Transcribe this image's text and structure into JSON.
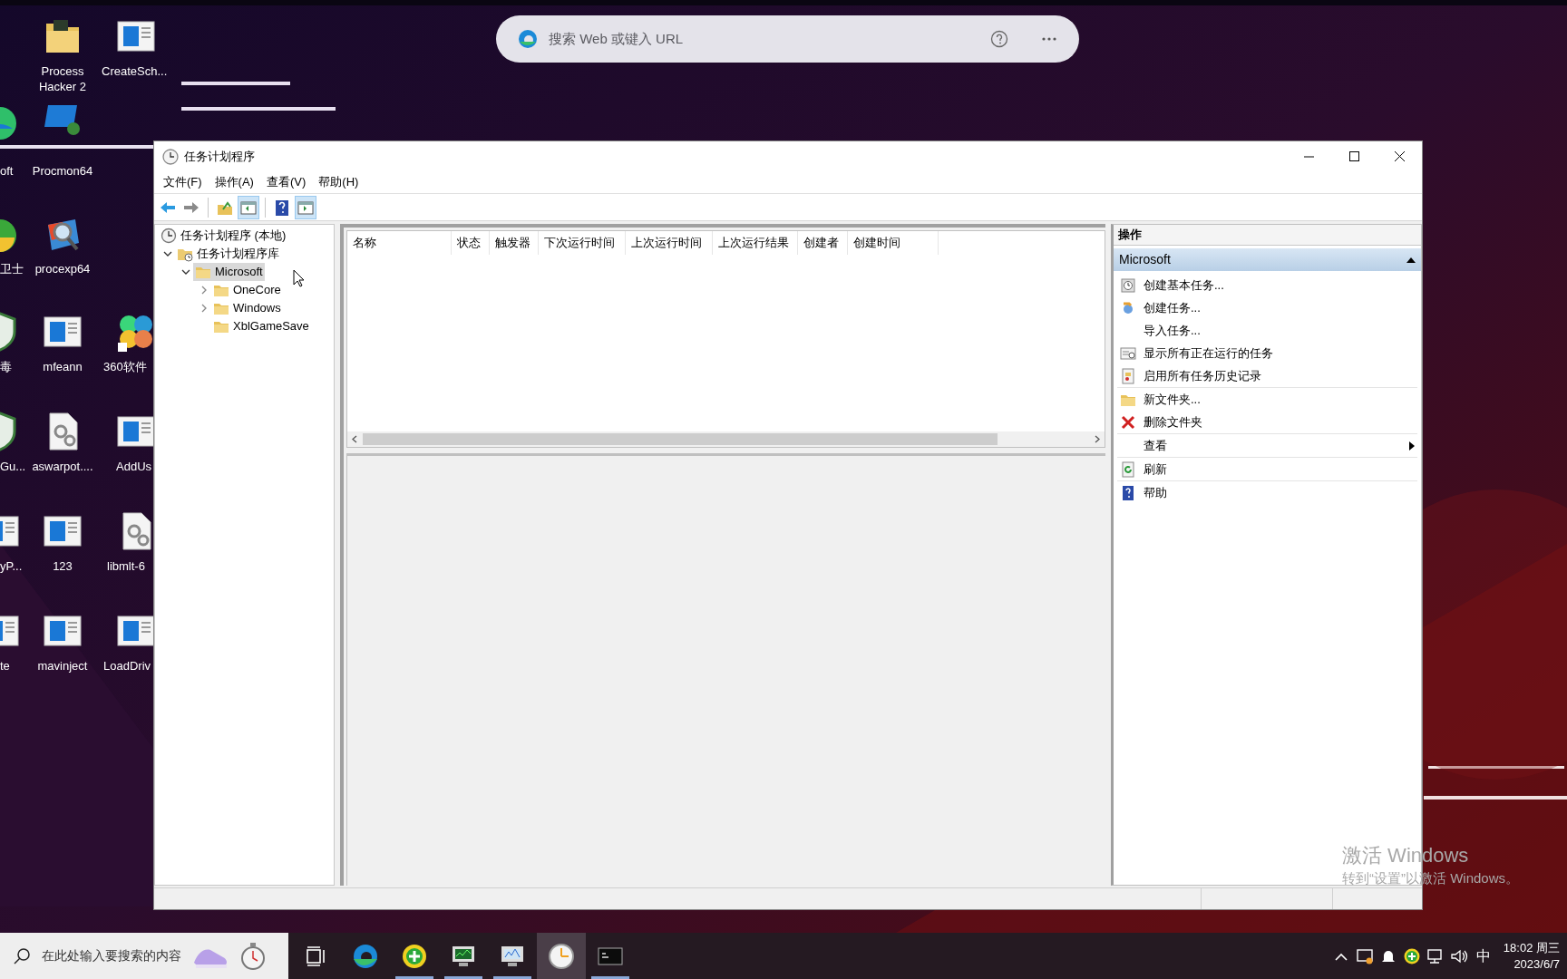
{
  "browser_search": {
    "placeholder": "搜索 Web 或键入 URL"
  },
  "desktop_icons": [
    {
      "label": "Process Hacker 2",
      "kind": "folder"
    },
    {
      "label": "CreateSch...",
      "kind": "doc"
    },
    {
      "label": "oft",
      "kind": "globe"
    },
    {
      "label": "Procmon64",
      "kind": "procmon"
    },
    {
      "label": "卫士",
      "kind": "ball"
    },
    {
      "label": "procexp64",
      "kind": "magnifier"
    },
    {
      "label": "毒",
      "kind": "shield"
    },
    {
      "label": "mfeann",
      "kind": "doc"
    },
    {
      "label": "360软件",
      "kind": "flower"
    },
    {
      "label": "Gu...",
      "kind": "shield"
    },
    {
      "label": "aswarpot....",
      "kind": "gear"
    },
    {
      "label": "AddUs",
      "kind": "doc"
    },
    {
      "label": "yP...",
      "kind": "doc"
    },
    {
      "label": "123",
      "kind": "doc"
    },
    {
      "label": "libmlt-6",
      "kind": "gear"
    },
    {
      "label": "te",
      "kind": "doc"
    },
    {
      "label": "mavinject",
      "kind": "doc"
    },
    {
      "label": "LoadDriv",
      "kind": "doc"
    }
  ],
  "window": {
    "title": "任务计划程序",
    "menu": [
      "文件(F)",
      "操作(A)",
      "查看(V)",
      "帮助(H)"
    ],
    "toolbar": [
      {
        "kind": "back"
      },
      {
        "kind": "forward"
      },
      {
        "kind": "separator"
      },
      {
        "kind": "up"
      },
      {
        "kind": "tree",
        "on": true
      },
      {
        "kind": "separator"
      },
      {
        "kind": "help"
      },
      {
        "kind": "actions",
        "on": true
      }
    ],
    "tree": [
      {
        "label": "任务计划程序 (本地)",
        "kind": "clock",
        "expandable": false,
        "selected": false,
        "children": [
          {
            "label": "任务计划程序库",
            "kind": "library",
            "expandable": true,
            "expanded": true,
            "selected": false,
            "children": [
              {
                "label": "Microsoft",
                "kind": "folder",
                "expandable": true,
                "expanded": true,
                "selected": true,
                "children": [
                  {
                    "label": "OneCore",
                    "kind": "folder",
                    "expandable": true,
                    "expanded": false,
                    "selected": false
                  },
                  {
                    "label": "Windows",
                    "kind": "folder",
                    "expandable": true,
                    "expanded": false,
                    "selected": false
                  },
                  {
                    "label": "XblGameSave",
                    "kind": "folder",
                    "expandable": false,
                    "selected": false
                  }
                ]
              }
            ]
          }
        ]
      }
    ],
    "table": {
      "columns": [
        "名称",
        "状态",
        "触发器",
        "下次运行时间",
        "上次运行时间",
        "上次运行结果",
        "创建者",
        "创建时间"
      ]
    },
    "actions": {
      "title": "操作",
      "group": {
        "label": "Microsoft",
        "expanded": true
      },
      "sections": [
        [
          {
            "label": "创建基本任务...",
            "kind": "basic-task",
            "submenu": false
          },
          {
            "label": "创建任务...",
            "kind": "task",
            "submenu": false
          },
          {
            "label": "导入任务...",
            "kind": "plain",
            "submenu": false
          },
          {
            "label": "显示所有正在运行的任务",
            "kind": "running",
            "submenu": false
          },
          {
            "label": "启用所有任务历史记录",
            "kind": "history",
            "submenu": false
          }
        ],
        [
          {
            "label": "新文件夹...",
            "kind": "new-folder",
            "submenu": false
          },
          {
            "label": "删除文件夹",
            "kind": "delete",
            "submenu": false
          }
        ],
        [
          {
            "label": "查看",
            "kind": "plain",
            "submenu": true
          }
        ],
        [
          {
            "label": "刷新",
            "kind": "refresh",
            "submenu": false
          }
        ],
        [
          {
            "label": "帮助",
            "kind": "help",
            "submenu": false
          }
        ]
      ]
    }
  },
  "activation": {
    "title": "激活 Windows",
    "subtitle": "转到“设置”以激活 Windows。"
  },
  "taskbar": {
    "search": {
      "placeholder": "在此处输入要搜索的内容"
    },
    "apps": [
      {
        "kind": "taskview",
        "running": false,
        "selected": false
      },
      {
        "kind": "edge",
        "running": false,
        "selected": false
      },
      {
        "kind": "plus",
        "running": true,
        "selected": false
      },
      {
        "kind": "monitor",
        "running": true,
        "selected": false
      },
      {
        "kind": "perf",
        "running": true,
        "selected": false
      },
      {
        "kind": "clock",
        "running": false,
        "selected": true
      },
      {
        "kind": "terminal",
        "running": true,
        "selected": false
      }
    ],
    "tray": {
      "ime": "中",
      "time": "18:02 周三",
      "date": "2023/6/7"
    }
  }
}
